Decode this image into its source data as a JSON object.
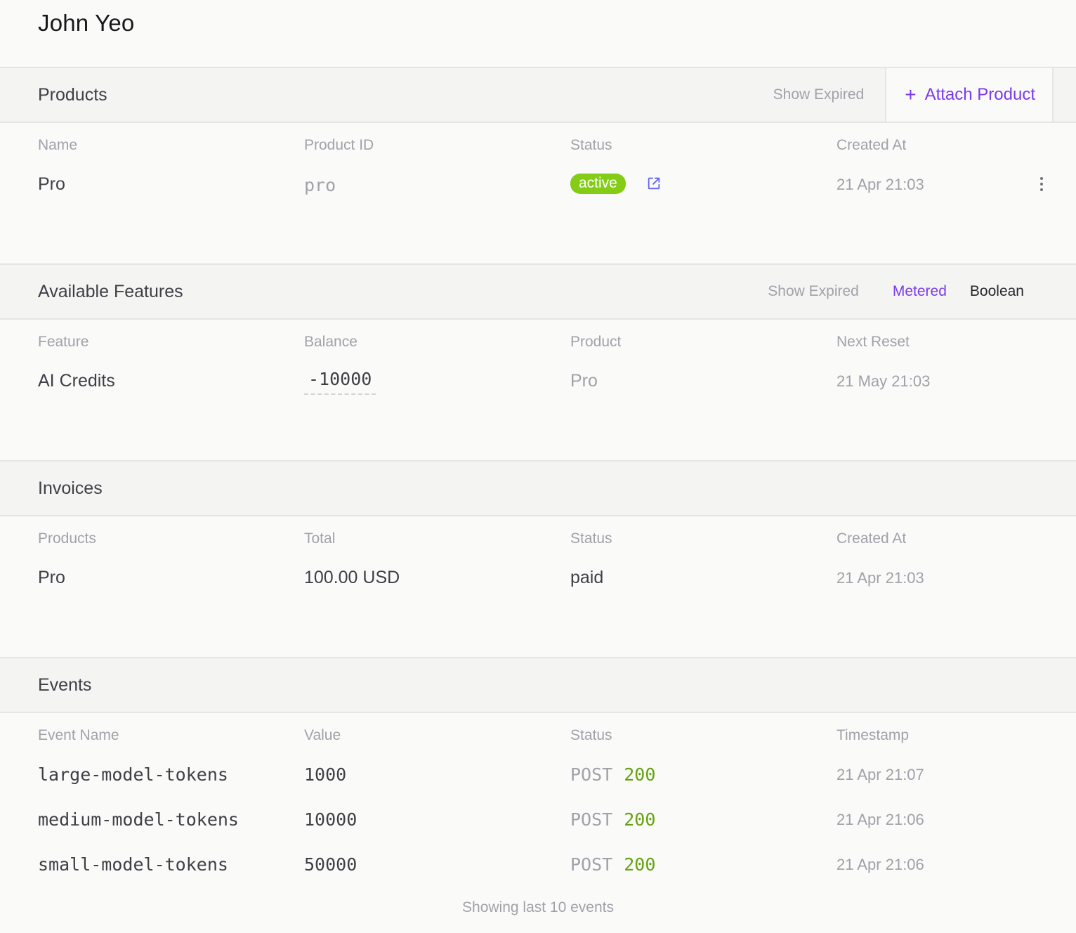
{
  "customer": {
    "name": "John Yeo"
  },
  "products": {
    "title": "Products",
    "show_expired": "Show Expired",
    "attach_label": "Attach Product",
    "columns": [
      "Name",
      "Product ID",
      "Status",
      "Created At"
    ],
    "rows": [
      {
        "name": "Pro",
        "product_id": "pro",
        "status": "active",
        "created_at": "21 Apr 21:03"
      }
    ]
  },
  "features": {
    "title": "Available Features",
    "show_expired": "Show Expired",
    "tabs": [
      "Metered",
      "Boolean"
    ],
    "active_tab": "Metered",
    "columns": [
      "Feature",
      "Balance",
      "Product",
      "Next Reset"
    ],
    "rows": [
      {
        "feature": "AI Credits",
        "balance": "-10000",
        "product": "Pro",
        "next_reset": "21 May 21:03"
      }
    ]
  },
  "invoices": {
    "title": "Invoices",
    "columns": [
      "Products",
      "Total",
      "Status",
      "Created At"
    ],
    "rows": [
      {
        "products": "Pro",
        "total": "100.00 USD",
        "status": "paid",
        "created_at": "21 Apr 21:03"
      }
    ]
  },
  "events": {
    "title": "Events",
    "columns": [
      "Event Name",
      "Value",
      "Status",
      "Timestamp"
    ],
    "rows": [
      {
        "event_name": "large-model-tokens",
        "value": "1000",
        "method": "POST",
        "code": "200",
        "timestamp": "21 Apr 21:07"
      },
      {
        "event_name": "medium-model-tokens",
        "value": "10000",
        "method": "POST",
        "code": "200",
        "timestamp": "21 Apr 21:06"
      },
      {
        "event_name": "small-model-tokens",
        "value": "50000",
        "method": "POST",
        "code": "200",
        "timestamp": "21 Apr 21:06"
      }
    ],
    "footer": "Showing last 10 events"
  },
  "colors": {
    "accent": "#7c3aed",
    "active_badge": "#84cc16",
    "status_ok": "#65a30d"
  },
  "icons": {
    "attach": "plus-icon",
    "external": "external-link-icon",
    "menu": "kebab-menu-icon"
  }
}
